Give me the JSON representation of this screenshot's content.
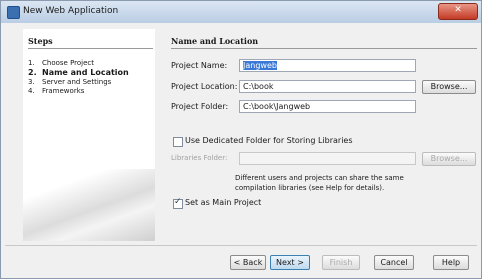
{
  "window": {
    "title": "New Web Application"
  },
  "steps": {
    "title": "Steps",
    "items": [
      {
        "num": "1.",
        "label": "Choose Project"
      },
      {
        "num": "2.",
        "label": "Name and Location"
      },
      {
        "num": "3.",
        "label": "Server and Settings"
      },
      {
        "num": "4.",
        "label": "Frameworks"
      }
    ]
  },
  "panel": {
    "title": "Name and Location",
    "project_name_label": "Project Name:",
    "project_name_value": "Jangweb",
    "project_location_label": "Project Location:",
    "project_location_value": "C:\\book",
    "project_folder_label": "Project Folder:",
    "project_folder_value": "C:\\book\\Jangweb",
    "browse_label": "Browse...",
    "dedicated_folder_label": "Use Dedicated Folder for Storing Libraries",
    "libraries_folder_label": "Libraries Folder:",
    "libraries_folder_value": "",
    "browse_disabled_label": "Browse...",
    "note_line1": "Different users and projects can share the same",
    "note_line2": "compilation libraries (see Help for details).",
    "main_project_label": "Set as Main Project",
    "main_project_checked": true
  },
  "footer": {
    "back_label": "< Back",
    "next_label": "Next >",
    "finish_label": "Finish",
    "cancel_label": "Cancel",
    "help_label": "Help"
  }
}
